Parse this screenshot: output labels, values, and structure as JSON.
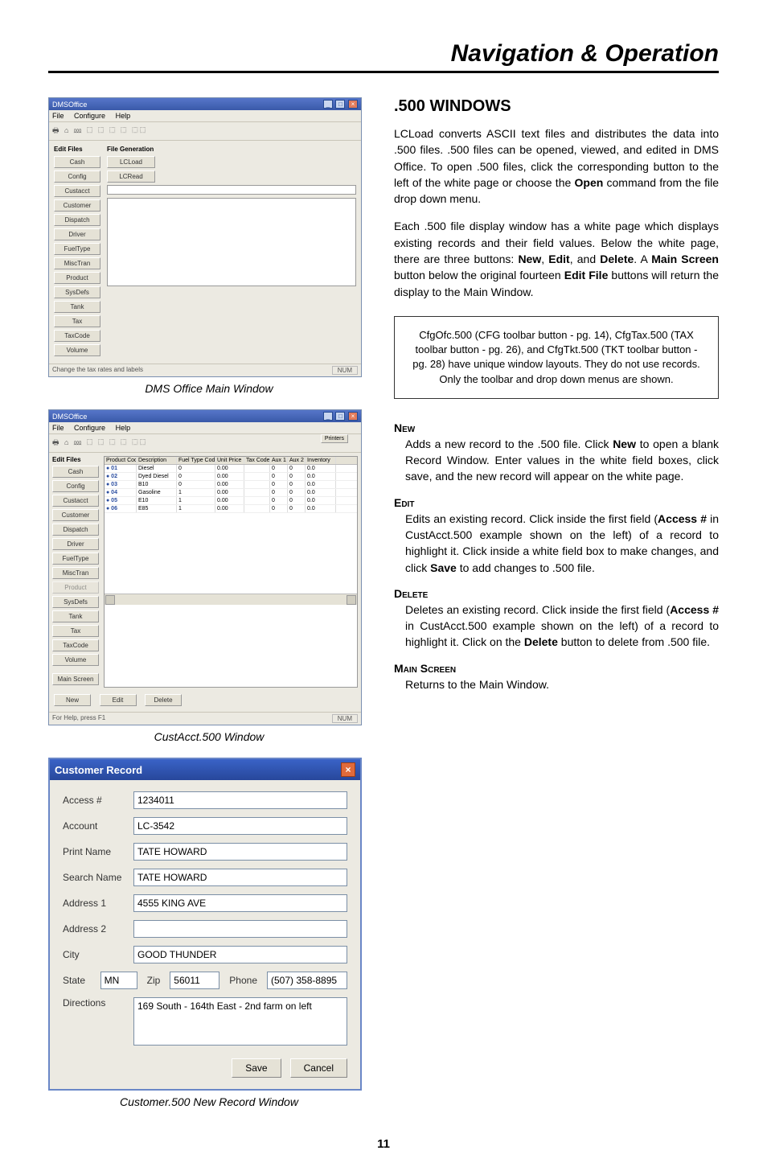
{
  "header": {
    "title": "Navigation & Operation"
  },
  "page_number": "11",
  "captions": {
    "main_window": "DMS Office Main Window",
    "custacct": "CustAcct.500 Window",
    "customer_record": "Customer.500 New Record Window"
  },
  "right": {
    "section_title": ".500 WINDOWS",
    "para1_a": "LCLoad converts ASCII text files and distributes the data into .500 files. .500 files can be opened, viewed, and edited in DMS Office. To open .500 files, click the corresponding button to the left of the white page or choose the ",
    "para1_open": "Open",
    "para1_b": " command from the file drop down menu.",
    "para2_a": "Each .500 file display window has a white page which displays existing records and their field values. Below the white page, there are three buttons: ",
    "para2_new": "New",
    "para2_mid1": ", ",
    "para2_edit": "Edit",
    "para2_mid2": ", and ",
    "para2_delete": "Delete",
    "para2_mid3": ". A ",
    "para2_main": "Main Screen",
    "para2_mid4": " button below the original fourteen ",
    "para2_editfile": "Edit File",
    "para2_b": " buttons will return the display to the Main Window.",
    "note": "CfgOfc.500 (CFG toolbar button - pg. 14), CfgTax.500 (TAX toolbar button - pg. 26), and CfgTkt.500 (TKT toolbar button - pg. 28) have unique window layouts. They do not use records. Only the toolbar and drop down menus are shown.",
    "new_head": "New",
    "new_body_a": "Adds a new record to the .500 file. Click ",
    "new_body_new": "New",
    "new_body_b": " to open a blank Record Window. Enter values in the white field boxes, click save, and the new record will appear on the white page.",
    "edit_head": "Edit",
    "edit_body_a": "Edits an existing record. Click inside the first field (",
    "edit_body_access": "Access #",
    "edit_body_b": " in CustAcct.500 example shown on the left) of a record to highlight it. Click inside a white field box to make changes, and click ",
    "edit_body_save": "Save",
    "edit_body_c": " to add changes to .500 file.",
    "delete_head": "Delete",
    "delete_body_a": "Deletes an existing record. Click inside the first field (",
    "delete_body_access": "Access #",
    "delete_body_b": " in CustAcct.500 example shown on the left) of a record to highlight it. Click on the ",
    "delete_body_delete": "Delete",
    "delete_body_c": " button to delete from .500 file.",
    "mainscreen_head": "Main Screen",
    "mainscreen_body": "Returns to the Main Window."
  },
  "win1": {
    "title": "DMSOffice",
    "menus": [
      "File",
      "Configure",
      "Help"
    ],
    "toolbar_glyphs": "🖶  ⌂ ⅏  ⬚ ⬚ ⬚ ⬚  ⬚⬚",
    "editfiles_label": "Edit Files",
    "filegen_label": "File Generation",
    "sidebar": [
      "Cash",
      "Config",
      "Custacct",
      "Customer",
      "Dispatch",
      "Driver",
      "FuelType",
      "MiscTran",
      "Product",
      "SysDefs",
      "Tank",
      "Tax",
      "TaxCode",
      "Volume"
    ],
    "filegen_buttons": [
      "LCLoad",
      "LCRead"
    ],
    "status_left": "Change the tax rates and labels",
    "status_right": "NUM"
  },
  "win2": {
    "title": "DMSOffice",
    "menus": [
      "File",
      "Configure",
      "Help"
    ],
    "printer_btn": "Printers",
    "editfiles_label": "Edit Files",
    "sidebar": [
      "Cash",
      "Config",
      "Custacct",
      "Customer",
      "Dispatch",
      "Driver",
      "FuelType",
      "MiscTran",
      "Product",
      "SysDefs",
      "Tank",
      "Tax",
      "TaxCode",
      "Volume"
    ],
    "main_screen_btn": "Main Screen",
    "columns": [
      "Product Code",
      "Description",
      "Fuel Type Code",
      "Unit Price",
      "Tax Code",
      "Aux 1",
      "Aux 2",
      "Inventory"
    ],
    "rows": [
      {
        "c0": "● 01",
        "c1": "Diesel",
        "c2": "0",
        "c3": "0.00",
        "c4": "",
        "c5": "0",
        "c6": "0",
        "c7": "0.0"
      },
      {
        "c0": "● 02",
        "c1": "Dyed Diesel",
        "c2": "0",
        "c3": "0.00",
        "c4": "",
        "c5": "0",
        "c6": "0",
        "c7": "0.0"
      },
      {
        "c0": "● 03",
        "c1": "B10",
        "c2": "0",
        "c3": "0.00",
        "c4": "",
        "c5": "0",
        "c6": "0",
        "c7": "0.0"
      },
      {
        "c0": "● 04",
        "c1": "Gasoline",
        "c2": "1",
        "c3": "0.00",
        "c4": "",
        "c5": "0",
        "c6": "0",
        "c7": "0.0"
      },
      {
        "c0": "● 05",
        "c1": "E10",
        "c2": "1",
        "c3": "0.00",
        "c4": "",
        "c5": "0",
        "c6": "0",
        "c7": "0.0"
      },
      {
        "c0": "● 06",
        "c1": "E85",
        "c2": "1",
        "c3": "0.00",
        "c4": "",
        "c5": "0",
        "c6": "0",
        "c7": "0.0"
      }
    ],
    "buttons": [
      "New",
      "Edit",
      "Delete"
    ],
    "status_left": "For Help, press F1",
    "status_right": "NUM"
  },
  "recwin": {
    "title": "Customer Record",
    "fields": {
      "access_label": "Access #",
      "access_val": "1234011",
      "account_label": "Account",
      "account_val": "LC-3542",
      "printname_label": "Print Name",
      "printname_val": "TATE HOWARD",
      "searchname_label": "Search Name",
      "searchname_val": "TATE HOWARD",
      "addr1_label": "Address 1",
      "addr1_val": "4555 KING AVE",
      "addr2_label": "Address 2",
      "addr2_val": "",
      "city_label": "City",
      "city_val": "GOOD THUNDER",
      "state_label": "State",
      "state_val": "MN",
      "zip_label": "Zip",
      "zip_val": "56011",
      "phone_label": "Phone",
      "phone_val": "(507) 358-8895",
      "directions_label": "Directions",
      "directions_val": "169 South - 164th East - 2nd farm on left"
    },
    "buttons": {
      "save": "Save",
      "cancel": "Cancel"
    }
  }
}
